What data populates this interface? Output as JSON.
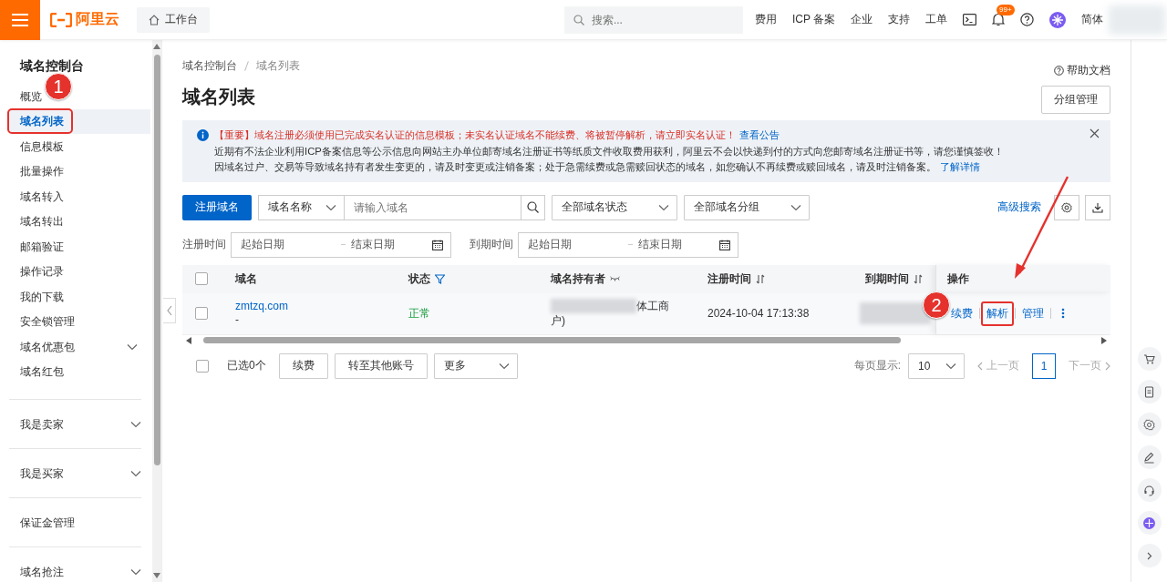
{
  "top_bar": {
    "brand": "阿里云",
    "workbench": "工作台",
    "search": {
      "placeholder": "搜索..."
    },
    "links": [
      "费用",
      "ICP 备案",
      "企业",
      "支持",
      "工单"
    ],
    "notification_badge": "99+",
    "language": "简体"
  },
  "sidebar": {
    "title": "域名控制台",
    "sections": [
      {
        "items": [
          {
            "label": "概览",
            "selected": false,
            "highlighted": false,
            "expandable": false
          },
          {
            "label": "域名列表",
            "selected": true,
            "highlighted": true,
            "expandable": false
          },
          {
            "label": "信息模板",
            "selected": false,
            "highlighted": false,
            "expandable": false
          },
          {
            "label": "批量操作",
            "selected": false,
            "highlighted": false,
            "expandable": false
          },
          {
            "label": "域名转入",
            "selected": false,
            "highlighted": false,
            "expandable": false
          },
          {
            "label": "域名转出",
            "selected": false,
            "highlighted": false,
            "expandable": false
          },
          {
            "label": "邮箱验证",
            "selected": false,
            "highlighted": false,
            "expandable": false
          },
          {
            "label": "操作记录",
            "selected": false,
            "highlighted": false,
            "expandable": false
          },
          {
            "label": "我的下载",
            "selected": false,
            "highlighted": false,
            "expandable": false
          },
          {
            "label": "安全锁管理",
            "selected": false,
            "highlighted": false,
            "expandable": false
          },
          {
            "label": "域名优惠包",
            "selected": false,
            "highlighted": false,
            "expandable": true
          },
          {
            "label": "域名红包",
            "selected": false,
            "highlighted": false,
            "expandable": false
          }
        ]
      },
      {
        "items": [
          {
            "label": "我是卖家",
            "selected": false,
            "highlighted": false,
            "expandable": true
          }
        ]
      },
      {
        "items": [
          {
            "label": "我是买家",
            "selected": false,
            "highlighted": false,
            "expandable": true
          }
        ]
      },
      {
        "items": [
          {
            "label": "保证金管理",
            "selected": false,
            "highlighted": false,
            "expandable": false
          }
        ]
      },
      {
        "items": [
          {
            "label": "域名抢注",
            "selected": false,
            "highlighted": false,
            "expandable": true
          }
        ]
      }
    ]
  },
  "breadcrumb": [
    "域名控制台",
    "域名列表"
  ],
  "help_link": "帮助文档",
  "page_title": "域名列表",
  "group_button": "分组管理",
  "notice": {
    "lines": [
      {
        "kind": "warning",
        "text": "【重要】域名注册必须使用已完成实名认证的信息模板；未实名认证域名不能续费、将被暂停解析，请立即实名认证！",
        "link": "查看公告"
      },
      {
        "kind": "normal",
        "text": "近期有不法企业利用ICP备案信息等公示信息向网站主办单位邮寄域名注册证书等纸质文件收取费用获利，阿里云不会以快递到付的方式向您邮寄域名注册证书等，请您谨慎签收！"
      },
      {
        "kind": "normal",
        "text": "因域名过户、交易等导致域名持有者发生变更的，请及时变更或注销备案；处于急需续费或急需赎回状态的域名，如您确认不再续费或赎回域名，请及时注销备案。",
        "link": "了解详情"
      }
    ]
  },
  "filters": {
    "register_button": "注册域名",
    "search_type": "域名名称",
    "domain_input": {
      "placeholder": "请输入域名"
    },
    "status_select": "全部域名状态",
    "group_select": "全部域名分组",
    "advanced_search": "高级搜索",
    "date_ranges": [
      {
        "label": "注册时间",
        "start_placeholder": "起始日期",
        "end_placeholder": "结束日期"
      },
      {
        "label": "到期时间",
        "start_placeholder": "起始日期",
        "end_placeholder": "结束日期"
      }
    ]
  },
  "table": {
    "header_checked": false,
    "columns": [
      {
        "label": "域名"
      },
      {
        "label": "状态"
      },
      {
        "label": "域名持有者"
      },
      {
        "label": "注册时间"
      },
      {
        "label": "到期时间"
      },
      {
        "label": "操作"
      }
    ],
    "rows": [
      {
        "checked": false,
        "domain": "zmtzq.com",
        "domain_note": "-",
        "status": "正常",
        "holder_lines": [
          "体工商",
          "户)"
        ],
        "registered": "2024-10-04 17:13:38",
        "actions": [
          {
            "label": "续费",
            "highlighted": false
          },
          {
            "label": "解析",
            "highlighted": true
          },
          {
            "label": "管理",
            "highlighted": false
          }
        ]
      }
    ]
  },
  "footer": {
    "select_all_checked": false,
    "selected_count": "已选0个",
    "buttons": [
      "续费",
      "转至其他账号"
    ],
    "more_select": "更多",
    "page_size_label": "每页显示:",
    "page_size": "10",
    "prev": {
      "label": "上一页",
      "disabled": true
    },
    "pages": [
      {
        "label": "1",
        "selected": true
      }
    ],
    "next": {
      "label": "下一页",
      "disabled": true
    }
  },
  "annotations": [
    {
      "kind": "step",
      "label": "1"
    },
    {
      "kind": "step",
      "label": "2"
    },
    {
      "kind": "arrow"
    }
  ]
}
